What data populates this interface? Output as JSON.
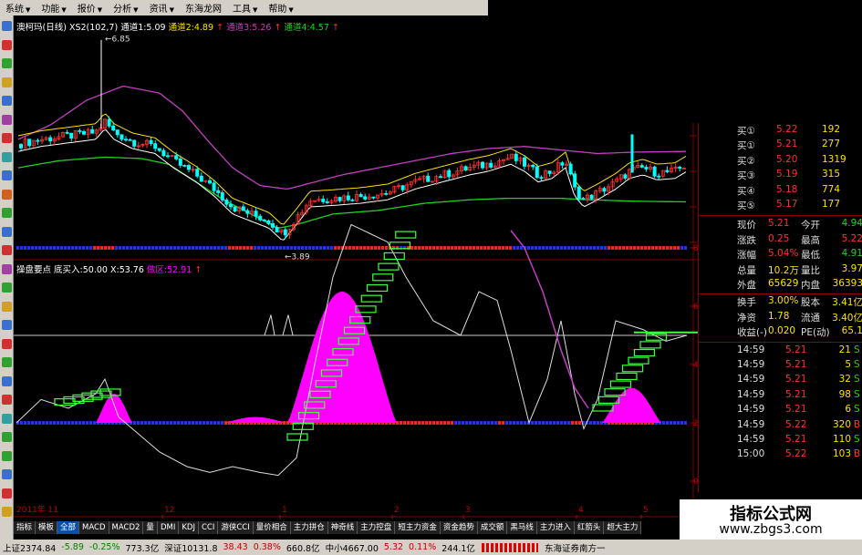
{
  "menu": [
    {
      "label": "系统",
      "arrow": "▼"
    },
    {
      "label": "功能",
      "arrow": "▼"
    },
    {
      "label": "报价",
      "arrow": "▼"
    },
    {
      "label": "分析",
      "arrow": "▼"
    },
    {
      "label": "资讯",
      "arrow": "▼"
    },
    {
      "label": "东海龙网",
      "arrow": ""
    },
    {
      "label": "工具",
      "arrow": "▼"
    },
    {
      "label": "帮助",
      "arrow": "▼"
    }
  ],
  "main_chart": {
    "legend": {
      "name": "澳柯玛(日线)",
      "indicator": "XS2(102,7)",
      "ch1": "通道1:5.09",
      "ch2": "通道2:4.89",
      "ch3": "通道3:5.26",
      "ch4": "通道4:4.57"
    },
    "high_label": "6.85",
    "low_label": "3.89",
    "y_ticks": [
      "5.50",
      "5.00",
      "4.50",
      "4.00"
    ]
  },
  "sub_chart": {
    "legend": {
      "name": "操盘要点",
      "buy": "底买入:50.00",
      "x": "X:53.76",
      "zone": "做区:52.91"
    },
    "y_ticks": [
      "80.00",
      "60.00",
      "40.00",
      "20.00",
      "0.00"
    ]
  },
  "x_axis": {
    "year_label": "2011年 11",
    "months": [
      "12",
      "1",
      "2",
      "3",
      "4",
      "5"
    ]
  },
  "quote": {
    "order_book": [
      {
        "label": "买①",
        "price": "5.22",
        "vol": "192"
      },
      {
        "label": "买①",
        "price": "5.21",
        "vol": "277"
      },
      {
        "label": "买②",
        "price": "5.20",
        "vol": "1319"
      },
      {
        "label": "买③",
        "price": "5.19",
        "vol": "315"
      },
      {
        "label": "买④",
        "price": "5.18",
        "vol": "774"
      },
      {
        "label": "买⑤",
        "price": "5.17",
        "vol": "177"
      }
    ],
    "stats": [
      {
        "l1": "现价",
        "v1": "5.21",
        "l2": "今开",
        "v2": "4.94"
      },
      {
        "l1": "涨跌",
        "v1": "0.25",
        "l2": "最高",
        "v2": "5.22"
      },
      {
        "l1": "涨幅",
        "v1": "5.04%",
        "l2": "最低",
        "v2": "4.91"
      },
      {
        "l1": "总量",
        "v1": "10.2万",
        "l2": "量比",
        "v2": "3.97"
      },
      {
        "l1": "外盘",
        "v1": "65629",
        "l2": "内盘",
        "v2": "36393"
      },
      {
        "l1": "换手",
        "v1": "3.00%",
        "l2": "股本",
        "v2": "3.41亿"
      },
      {
        "l1": "净资",
        "v1": "1.78",
        "l2": "流通",
        "v2": "3.40亿"
      },
      {
        "l1": "收益(-)",
        "v1": "0.020",
        "l2": "PE(动)",
        "v2": "65.1"
      }
    ],
    "trades": [
      {
        "time": "14:59",
        "price": "5.21",
        "vol": "21",
        "side": "S"
      },
      {
        "time": "14:59",
        "price": "5.21",
        "vol": "5",
        "side": "S"
      },
      {
        "time": "14:59",
        "price": "5.21",
        "vol": "32",
        "side": "S"
      },
      {
        "time": "14:59",
        "price": "5.21",
        "vol": "98",
        "side": "S"
      },
      {
        "time": "14:59",
        "price": "5.21",
        "vol": "6",
        "side": "S"
      },
      {
        "time": "14:59",
        "price": "5.22",
        "vol": "320",
        "side": "B"
      },
      {
        "time": "14:59",
        "price": "5.21",
        "vol": "110",
        "side": "S"
      },
      {
        "time": "15:00",
        "price": "5.22",
        "vol": "103",
        "side": "B"
      }
    ]
  },
  "tabs": [
    "指标",
    "模板",
    "全部",
    "MACD",
    "MACD2",
    "量",
    "DMI",
    "KDJ",
    "CCI",
    "游侠CCI",
    "量价相合",
    "主力拼仓",
    "神奇线",
    "主力控盘",
    "短主力资金",
    "资金趋势",
    "成交额",
    "黑马线",
    "主力进入",
    "红箭头",
    "超大主力"
  ],
  "status": {
    "idx1": "上证2374.84",
    "chg1": "-5.89",
    "pct1": "-0.25%",
    "amt1": "773.3亿",
    "idx2": "深证10131.8",
    "chg2": "38.43",
    "pct2": "0.38%",
    "amt2": "660.8亿",
    "idx3": "中小4667.00",
    "chg3": "5.32",
    "pct3": "0.11%",
    "amt3": "244.1亿",
    "broker": "东海证券南方一"
  },
  "watermark": {
    "title": "指标公式网",
    "url": "www.zbgs3.com"
  },
  "colors": {
    "up": "#ff3030",
    "down": "#00ffff",
    "ma": "#ffffff",
    "ch_yellow": "#ffe000",
    "ch_purple": "#c040c0",
    "ch_green": "#20d020",
    "magenta": "#ff00ff",
    "stair": "#40ff40"
  }
}
